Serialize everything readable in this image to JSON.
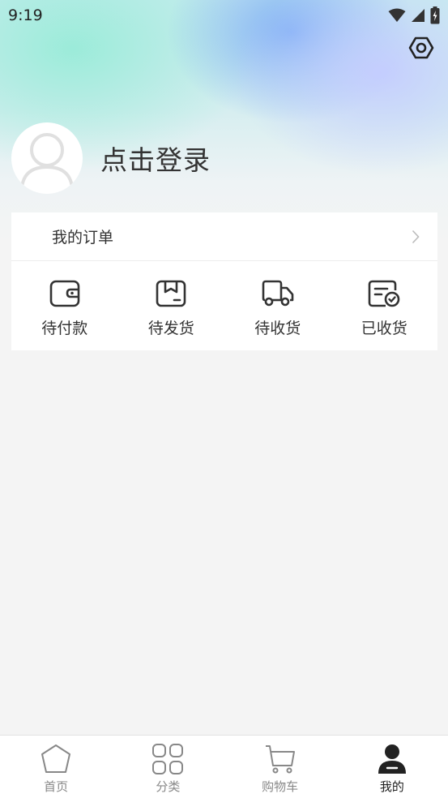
{
  "status_bar": {
    "time": "9:19"
  },
  "profile": {
    "login_text": "点击登录"
  },
  "orders": {
    "title": "我的订单",
    "items": [
      {
        "label": "待付款",
        "icon": "wallet-icon"
      },
      {
        "label": "待发货",
        "icon": "box-icon"
      },
      {
        "label": "待收货",
        "icon": "truck-icon"
      },
      {
        "label": "已收货",
        "icon": "received-check-icon"
      }
    ]
  },
  "tabbar": {
    "active": 3,
    "items": [
      {
        "label": "首页",
        "icon": "home-pentagon-icon"
      },
      {
        "label": "分类",
        "icon": "category-grid-icon"
      },
      {
        "label": "购物车",
        "icon": "cart-icon"
      },
      {
        "label": "我的",
        "icon": "user-icon"
      }
    ]
  },
  "colors": {
    "text": "#333333",
    "inactive": "#888888",
    "background": "#f4f4f4"
  }
}
